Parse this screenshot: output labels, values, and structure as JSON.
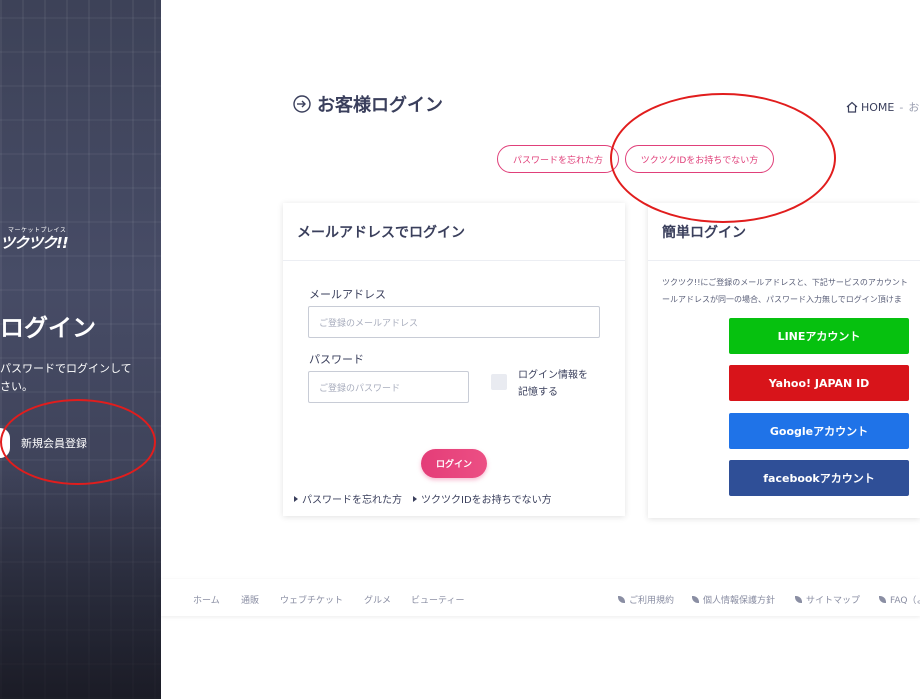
{
  "sidebar": {
    "tagline": "マーケットプレイス",
    "logo_text": "ツクツク!!",
    "heading": "ログイン",
    "description_line1": "パスワードでログインして",
    "description_line2": "さい。",
    "register_label": "新規会員登録"
  },
  "header": {
    "title": "お客様ログイン",
    "breadcrumb": {
      "home": "HOME",
      "separator": "-",
      "current": "お"
    }
  },
  "quick_links": {
    "forgot_password": "パスワードを忘れた方",
    "no_account": "ツクツクIDをお持ちでない方"
  },
  "email_login": {
    "title": "メールアドレスでログイン",
    "email_label": "メールアドレス",
    "email_placeholder": "ご登録のメールアドレス",
    "password_label": "パスワード",
    "password_placeholder": "ご登録のパスワード",
    "remember_line1": "ログイン情報を",
    "remember_line2": "記憶する",
    "submit_label": "ログイン",
    "forgot_link": "パスワードを忘れた方",
    "no_account_link": "ツクツクIDをお持ちでない方"
  },
  "easy_login": {
    "title": "簡単ログイン",
    "desc_line1": "ツクツク!!にご登録のメールアドレスと、下記サービスのアカウント",
    "desc_line2": "ールアドレスが同一の場合、パスワード入力無しでログイン頂けま",
    "buttons": [
      {
        "label": "LINEアカウント",
        "color": "#06c10f"
      },
      {
        "label": "Yahoo! JAPAN ID",
        "color": "#d8141a"
      },
      {
        "label": "Googleアカウント",
        "color": "#1f73e8"
      },
      {
        "label": "facebookアカウント",
        "color": "#2f4f97"
      }
    ]
  },
  "footer": {
    "nav": [
      "ホーム",
      "通販",
      "ウェブチケット",
      "グルメ",
      "ビューティー"
    ],
    "links": [
      "ご利用規約",
      "個人情報保護方針",
      "サイトマップ",
      "FAQ（よ"
    ]
  },
  "colors": {
    "accent": "#e0407a",
    "text": "#3a3f5c",
    "annotation": "#e11d1d"
  }
}
